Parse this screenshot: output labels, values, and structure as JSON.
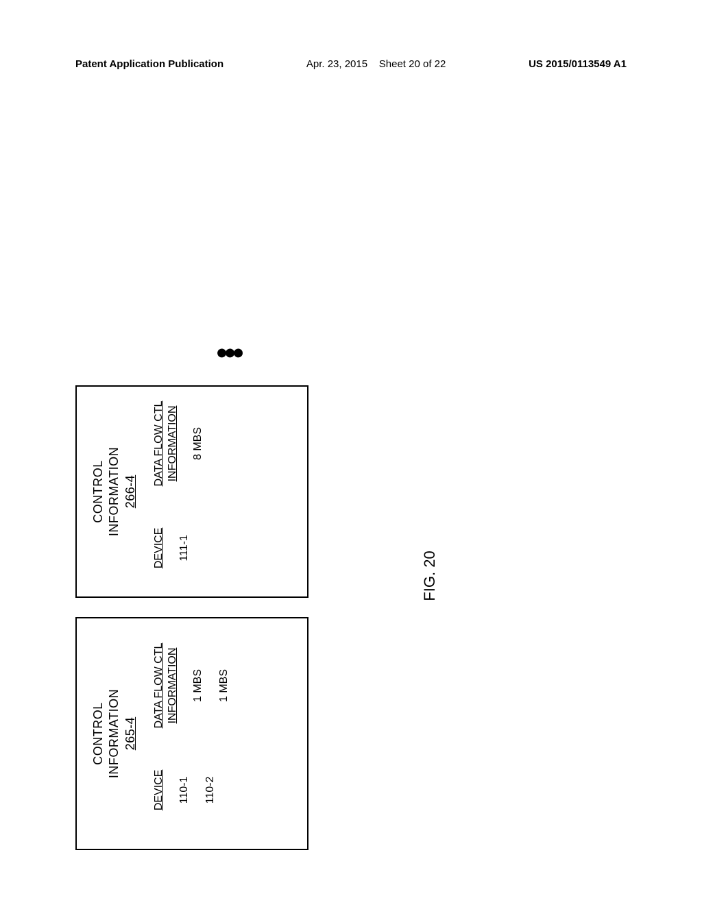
{
  "header": {
    "publication_label": "Patent Application Publication",
    "date": "Apr. 23, 2015",
    "sheet": "Sheet 20 of 22",
    "publication_number": "US 2015/0113549 A1"
  },
  "figure": {
    "caption": "FIG. 20",
    "ellipsis": "●"
  },
  "box_left": {
    "title_line1": "CONTROL",
    "title_line2": "INFORMATION",
    "ref": "265-4",
    "col_device_header": "DEVICE",
    "col_flow_header_line1": "DATA FLOW CTL",
    "col_flow_header_line2": "INFORMATION",
    "rows": [
      {
        "device": "110-1",
        "flow": "1 MBS"
      },
      {
        "device": "110-2",
        "flow": "1 MBS"
      }
    ]
  },
  "box_right": {
    "title_line1": "CONTROL",
    "title_line2": "INFORMATION",
    "ref": "266-4",
    "col_device_header": "DEVICE",
    "col_flow_header_line1": "DATA FLOW CTL",
    "col_flow_header_line2": "INFORMATION",
    "rows": [
      {
        "device": "111-1",
        "flow": "8 MBS"
      }
    ]
  }
}
